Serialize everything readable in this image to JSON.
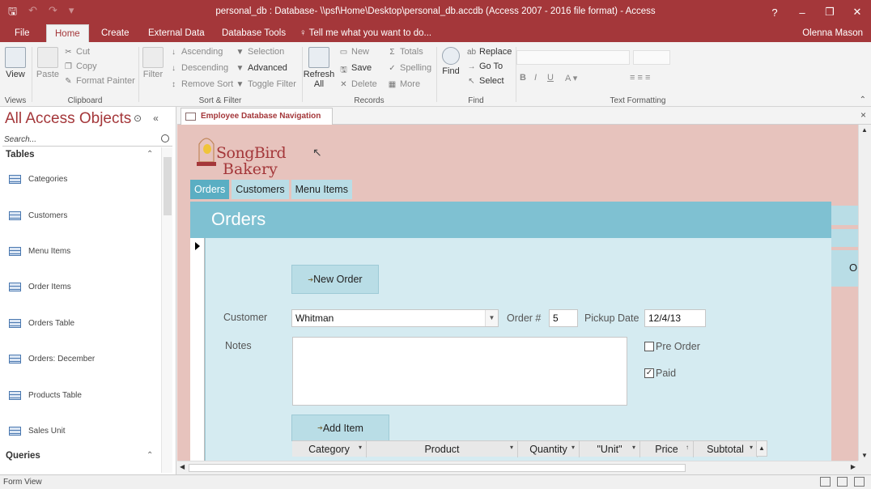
{
  "window": {
    "title": "personal_db : Database- \\\\psf\\Home\\Desktop\\personal_db.accdb (Access 2007 - 2016 file format) - Access",
    "help": "?",
    "minimize": "–",
    "restore": "❐",
    "close": "✕"
  },
  "qat": {
    "save": "🖫",
    "undo": "↶",
    "redo": "↷",
    "more": "▾"
  },
  "tabs": [
    "File",
    "Home",
    "Create",
    "External Data",
    "Database Tools"
  ],
  "tell_me": "Tell me what you want to do...",
  "user": "Olenna Mason",
  "ribbon": {
    "view": "View",
    "paste": "Paste",
    "cut": "Cut",
    "copy": "Copy",
    "format_painter": "Format Painter",
    "filter": "Filter",
    "ascending": "Ascending",
    "descending": "Descending",
    "remove_sort": "Remove Sort",
    "selection": "Selection",
    "advanced": "Advanced",
    "toggle_filter": "Toggle Filter",
    "refresh": "Refresh",
    "refresh_all": "All",
    "new": "New",
    "save": "Save",
    "delete": "Delete",
    "totals": "Totals",
    "spelling": "Spelling",
    "more": "More",
    "find": "Find",
    "replace": "Replace",
    "goto": "Go To",
    "select": "Select",
    "groups": {
      "views": "Views",
      "clipboard": "Clipboard",
      "sort_filter": "Sort & Filter",
      "records": "Records",
      "find": "Find",
      "text_formatting": "Text Formatting"
    }
  },
  "nav": {
    "title": "All Access Objects",
    "collapse": "«",
    "search_placeholder": "Search...",
    "tables_header": "Tables",
    "tables": [
      "Categories",
      "Customers",
      "Menu Items",
      "Order Items",
      "Orders Table",
      "Orders: December",
      "Products Table",
      "Sales Unit"
    ],
    "queries_header": "Queries"
  },
  "doc_tab": "Employee Database Navigation",
  "doc_close": "×",
  "logo": {
    "line1": "SongBird",
    "line2": "Bakery"
  },
  "form_tabs": [
    "Orders",
    "Customers",
    "Menu Items"
  ],
  "orders": {
    "heading": "Orders",
    "new_order": "New Order",
    "customer_label": "Customer",
    "customer_value": "Whitman",
    "order_label": "Order #",
    "order_value": "5",
    "pickup_label": "Pickup Date",
    "pickup_value": "12/4/13",
    "notes_label": "Notes",
    "pre_order": "Pre Order",
    "paid": "Paid",
    "paid_checked": true,
    "add_item": "Add Item",
    "columns": [
      "Category",
      "Product",
      "Quantity",
      "\"Unit\"",
      "Price",
      "Subtotal"
    ]
  },
  "right_panel_letter": "O",
  "status": {
    "text": "Form View"
  },
  "colors": {
    "accent": "#a4373a",
    "form_bg": "#e7c3bd",
    "subform": "#7fc1d2"
  }
}
